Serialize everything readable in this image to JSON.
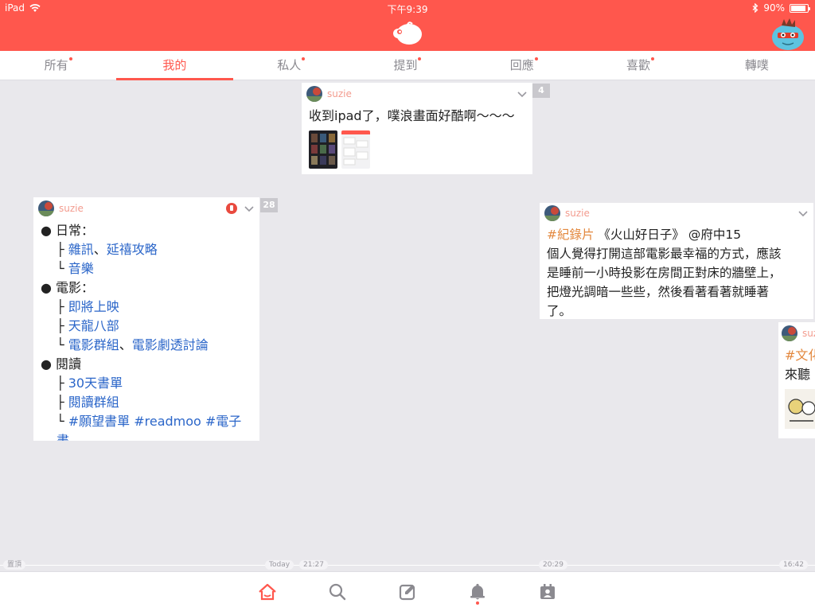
{
  "status": {
    "device": "iPad",
    "time": "下午9:39",
    "battery": "90%",
    "battery_level": 0.9
  },
  "tabs": [
    {
      "label": "所有",
      "dot": true
    },
    {
      "label": "我的",
      "dot": false,
      "active": true
    },
    {
      "label": "私人",
      "dot": true
    },
    {
      "label": "提到",
      "dot": true
    },
    {
      "label": "回應",
      "dot": true
    },
    {
      "label": "喜歡",
      "dot": true
    },
    {
      "label": "轉噗",
      "dot": false
    }
  ],
  "posts": [
    {
      "user": "suzie",
      "count": "4",
      "text": "收到ipad了，噗浪畫面好酷啊～～～"
    },
    {
      "user": "suzie",
      "count": "28",
      "lines": [
        {
          "bullet": "● ",
          "text": "日常："
        },
        {
          "prefix": "├ ",
          "link": "雜訊",
          "sep": "、",
          "link2": "延禧攻略"
        },
        {
          "prefix": "└ ",
          "link": "音樂"
        },
        {
          "bullet": "● ",
          "text": "電影："
        },
        {
          "prefix": "├ ",
          "link": "即將上映"
        },
        {
          "prefix": "├ ",
          "link": "天龍八部"
        },
        {
          "prefix": "└ ",
          "link": "電影群組",
          "sep": "、",
          "link2": "電影劇透討論"
        },
        {
          "bullet": "● ",
          "text": "閱讀"
        },
        {
          "prefix": "├ ",
          "link": "30天書單"
        },
        {
          "prefix": "├ ",
          "link": "閱讀群組"
        },
        {
          "prefix": "└ ",
          "link": "#願望書單 #readmoo #電子書"
        }
      ]
    },
    {
      "user": "suzie",
      "tag": "#紀錄片",
      "line1": " 《火山好日子》 @府中15",
      "line2": "個人覺得打開這部電影最幸福的方式，應該",
      "line3": "是睡前一小時投影在房間正對床的牆壁上，",
      "line4": "把燈光調暗一些些，然後看著看著就睡著",
      "line5": "了。"
    },
    {
      "user": "suzie",
      "tag": "#文化",
      "text": "來聽"
    }
  ],
  "timeline": {
    "top_label": "置頂",
    "today": "Today",
    "t1": "21:27",
    "t2": "20:29",
    "t3": "16:42"
  },
  "colors": {
    "brand": "#ff574d",
    "link": "#2b66c9",
    "tag": "#e3883e",
    "username": "#f39c8f"
  },
  "bottom_nav": [
    "home-icon",
    "search-icon",
    "compose-icon",
    "bell-icon",
    "profile-card-icon"
  ]
}
